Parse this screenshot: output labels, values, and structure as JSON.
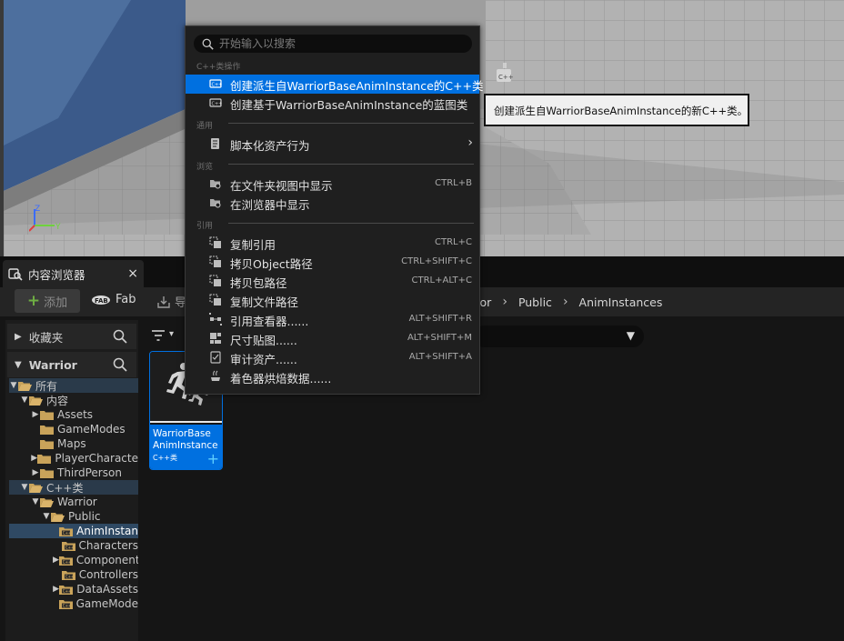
{
  "context_menu": {
    "search_placeholder": "开始输入以搜索",
    "sections": {
      "cpp": "C++类操作",
      "common": "通用",
      "browse": "浏览",
      "reference": "引用"
    },
    "items": {
      "create_derived_cpp": "创建派生自WarriorBaseAnimInstance的C++类",
      "create_blueprint": "创建基于WarriorBaseAnimInstance的蓝图类",
      "scripted_asset_actions": "脚本化资产行为",
      "show_in_folder_view": "在文件夹视图中显示",
      "show_in_folder_view_shortcut": "CTRL+B",
      "show_in_explorer": "在浏览器中显示",
      "copy_reference": "复制引用",
      "copy_reference_shortcut": "CTRL+C",
      "copy_object_path": "拷贝Object路径",
      "copy_object_path_shortcut": "CTRL+SHIFT+C",
      "copy_package_path": "拷贝包路径",
      "copy_package_path_shortcut": "CTRL+ALT+C",
      "copy_file_path": "复制文件路径",
      "reference_viewer": "引用查看器......",
      "reference_viewer_shortcut": "ALT+SHIFT+R",
      "size_map": "尺寸贴图......",
      "size_map_shortcut": "ALT+SHIFT+M",
      "audit_assets": "审计资产......",
      "audit_assets_shortcut": "ALT+SHIFT+A",
      "shader_cook_data": "着色器烘焙数据......"
    }
  },
  "tooltip": "创建派生自WarriorBaseAnimInstance的新C++类。",
  "content_browser": {
    "tab_title": "内容浏览器",
    "tab_close": "×",
    "toolbar": {
      "add_label": "添加",
      "fab_label": "Fab",
      "import_label": "导"
    },
    "breadcrumb": [
      "rrior",
      "Public",
      "AnimInstances"
    ],
    "favorites_label": "收藏夹",
    "project_label": "Warrior",
    "tree": [
      {
        "label": "所有",
        "depth": 0,
        "arrow": "open",
        "style": "hl",
        "folder": "open"
      },
      {
        "label": "内容",
        "depth": 1,
        "arrow": "open",
        "folder": "open"
      },
      {
        "label": "Assets",
        "depth": 2,
        "arrow": "closed",
        "folder": "closed"
      },
      {
        "label": "GameModes",
        "depth": 2,
        "arrow": "",
        "folder": "closed"
      },
      {
        "label": "Maps",
        "depth": 2,
        "arrow": "",
        "folder": "closed"
      },
      {
        "label": "PlayerCharacte",
        "depth": 2,
        "arrow": "closed",
        "folder": "closed"
      },
      {
        "label": "ThirdPerson",
        "depth": 2,
        "arrow": "closed",
        "folder": "closed"
      },
      {
        "label": "C++类",
        "depth": 1,
        "arrow": "open",
        "style": "hl",
        "folder": "open"
      },
      {
        "label": "Warrior",
        "depth": 2,
        "arrow": "open",
        "folder": "open"
      },
      {
        "label": "Public",
        "depth": 3,
        "arrow": "open",
        "folder": "open"
      },
      {
        "label": "AnimInstan",
        "depth": 4,
        "arrow": "",
        "style": "sel",
        "folder": "cpp"
      },
      {
        "label": "Characters",
        "depth": 4,
        "arrow": "",
        "folder": "cpp"
      },
      {
        "label": "Component",
        "depth": 4,
        "arrow": "closed",
        "folder": "cpp"
      },
      {
        "label": "Controllers",
        "depth": 4,
        "arrow": "",
        "folder": "cpp"
      },
      {
        "label": "DataAssets",
        "depth": 4,
        "arrow": "closed",
        "folder": "cpp"
      },
      {
        "label": "GameMode",
        "depth": 4,
        "arrow": "",
        "folder": "cpp"
      }
    ],
    "asset": {
      "name": "WarriorBase AnimInstance",
      "type": "C++类"
    }
  },
  "colors": {
    "accent": "#0070e0",
    "menu_bg": "#1f1f1f",
    "folder": "#c9a35a"
  }
}
